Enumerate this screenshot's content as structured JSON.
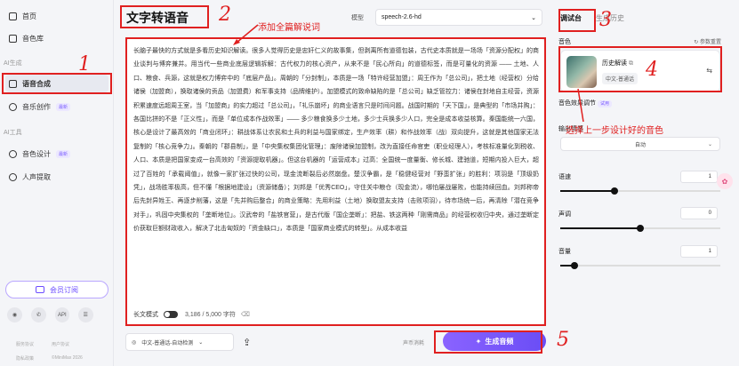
{
  "sidebar": {
    "items": [
      {
        "label": "首页",
        "icon": "home-icon"
      },
      {
        "label": "音色库",
        "icon": "library-icon"
      }
    ],
    "section_ai_gen": "AI生成",
    "gen_items": [
      {
        "label": "语音合成",
        "icon": "speech-icon",
        "badge": ""
      },
      {
        "label": "音乐创作",
        "icon": "music-icon",
        "badge": "最新"
      }
    ],
    "section_ai_tools": "AI工具",
    "tool_items": [
      {
        "label": "音色设计",
        "icon": "design-icon",
        "badge": "最新"
      },
      {
        "label": "人声提取",
        "icon": "vocal-icon",
        "badge": ""
      }
    ],
    "vip_label": "会员订阅",
    "bottom_icons": [
      "discord-icon",
      "wechat-icon",
      "API"
    ],
    "footer_links": [
      "服务协议",
      "用户协议",
      "隐私政策",
      "©MiniMax 2026"
    ]
  },
  "header": {
    "title": "文字转语音",
    "model_label": "模型",
    "model_value": "speech-2.6-hd"
  },
  "editor": {
    "text": "长脑子最快的方式就是多看历史知识解读。很多人觉得历史是忠奸仁义的故事集，但剥离所有道德包装，古代史本质就是一场场「资源分配权」的商业谈判与博弈兼并。用当代一些商业底层逻辑拆解：古代权力的核心资产，从来不是「民心所向」的道德标签，而是可量化的资源 —— 土地、人口、粮食、兵源，这就是权力博弈中的「底层产品」。周朝的「分封制」，本质是一场「特许经营加盟」：周王作为「总公司」，把土地（经营权）分给诸侯（加盟商），换取诸侯的贡品（加盟费）和军事支持（品牌维护）。加盟模式的致命缺陷的是「总公司」缺乏管控力：诸侯在封地自主经营，资源积累速度远超周王室，当「加盟商」的实力超过「总公司」，「礼乐崩坏」的商业语言只是时间问题。战国时期的「天下国」，是典型的「市场并购」：各国比拼的不是「正义性」，而是「单位成本作战效率」—— 多少粮食换多少土地，多少士兵换多少人口，完全是成本收益核算。秦国能统一六国，核心是设计了最高效的「商业闭环」：耕战体系让农民和土兵的利益与国家绑定，生产效率（耕）和作战效率（战）双向提升，这就是其他国家无法复制的「核心竞争力」。秦朝的「郡县制」，是「中央集权集团化管理」：废除诸侯加盟制，改为直接任命官吏（职业经理人），考核标准量化到税收、人口、本质是把国家变成一台高效的「资源提取机器」。但这台机器的「运营成本」过高：全国统一度量衡、修长城、建驰道，短期内投入巨大，超过了百姓的「承载阈值」，就像一家扩张过快的公司，现金流断裂后必然崩盘。楚汉争霸，是「稳健经营对「野蛮扩张」的胜利：项羽是「顶级奶凭」，战场胜率极高，但不懂「根据地建设」（资源储备）；刘邦是「优秀CEO」，守住关中粮仓（现金流），哪怕屡战屡败，也能持续回血。刘邦称帝后先封异姓王、再逐步削藩，这是「先并购后整合」的商业策略：先用利益（土地）换取盟友支持（击败项羽），待市场统一后，再清除「潜在竞争对手」，巩固中央集权的「垄断地位」。汉武帝的「盐铁官营」，是古代版「国企垄断」：把盐、铁这两种「刚需商品」的经营权收归中央，通过垄断定价获取巨额财政收入，解决了北击匈奴的「资金缺口」，本质是「国家商业模式的转型」。从成本收益",
    "long_text_mode_label": "长文模式",
    "char_count": "3,186 / 5,000 字符"
  },
  "bottom_bar": {
    "language": "中文-普通话-自动检测",
    "quota_label": "声币消耗",
    "generate_label": "生成音频"
  },
  "right_panel": {
    "tabs": [
      "调试台",
      "生成历史"
    ],
    "voice_label": "音色",
    "reference_label": "参数重置",
    "voice": {
      "name": "历史解读",
      "tag": "中文-普通话"
    },
    "effects_label": "音色效果调节",
    "effects_badge": "试用",
    "emotion_label": "输出情感",
    "emotion_value": "自动",
    "sliders": [
      {
        "label": "语速",
        "value": 1,
        "fraction": 0.34
      },
      {
        "label": "声调",
        "value": 0,
        "fraction": 0.5
      },
      {
        "label": "音量",
        "value": 1,
        "fraction": 0.09
      }
    ]
  },
  "annotations": {
    "num2": "2",
    "num3": "3",
    "num4": "4",
    "num5": "5",
    "num1": "1",
    "note_text": "添加全篇解说词",
    "note_voice": "选择上一步设计好的音色"
  },
  "colors": {
    "accent": "#7a5cff",
    "annotation": "#e02020"
  }
}
